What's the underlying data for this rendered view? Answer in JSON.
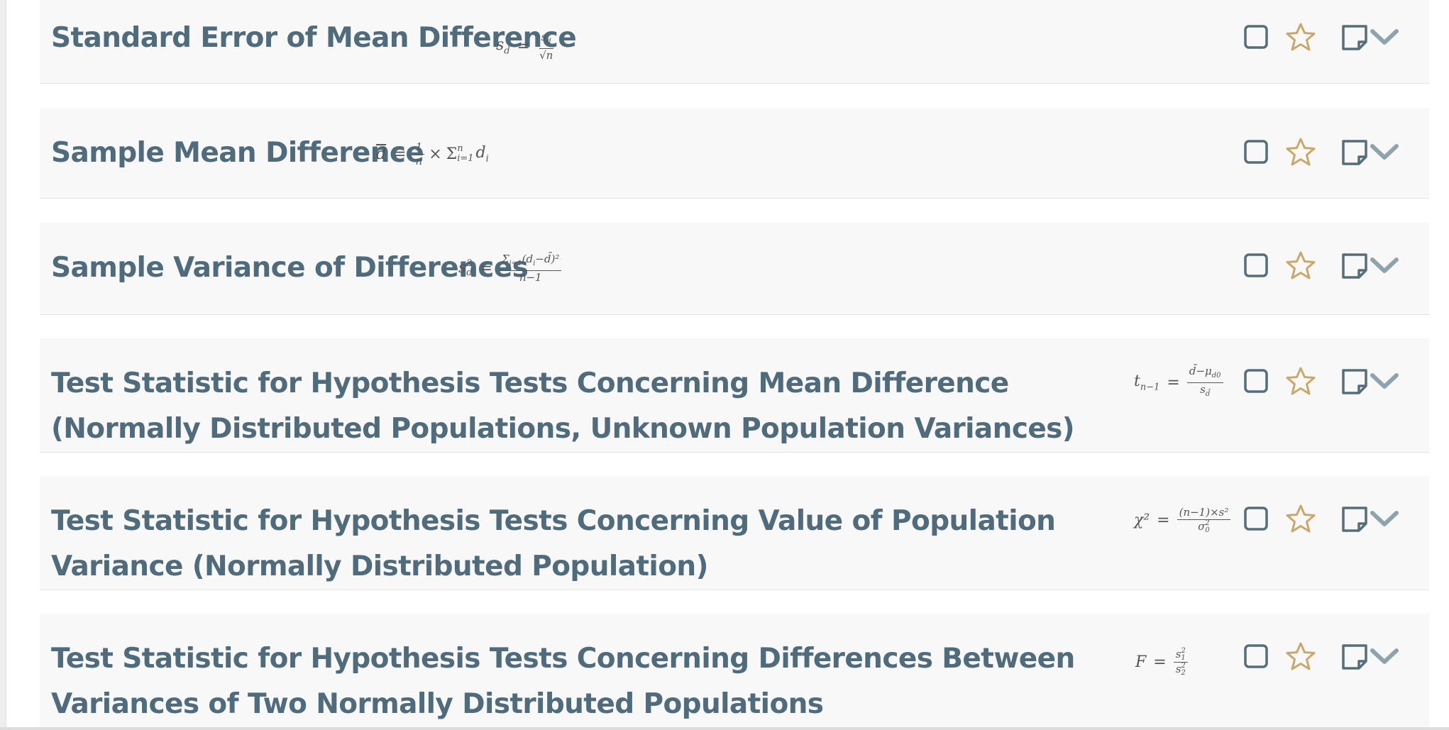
{
  "colors": {
    "title": "#4f6b7c",
    "icon_gray": "#546e7a",
    "star_gold": "#c8a86b",
    "chevron": "#8fa3ad",
    "card_bg": "#f8f8f8"
  },
  "icon_names": [
    "checkbox-icon",
    "star-icon",
    "note-icon",
    "chevron-down-icon"
  ],
  "formulas": [
    {
      "title": "Standard Error of Mean Difference",
      "lhs": "s_d̄",
      "rhs_num": "s_d",
      "rhs_den": "√n"
    },
    {
      "title": "Sample Mean Difference",
      "lhs": "d̄",
      "rhs": "1/n × Σ_{i=1}^{n} d_i"
    },
    {
      "title": "Sample Variance of Differences",
      "lhs": "s²_d",
      "rhs_num": "Σ_{i=1}^{n} (d_i − d̄)²",
      "rhs_den": "n−1"
    },
    {
      "title": "Test Statistic for Hypothesis Tests Concerning Mean Difference (Normally Distributed Populations, Unknown Population Variances)",
      "lhs": "t_{n−1}",
      "rhs_num": "d̄ − μ_{d0}",
      "rhs_den": "s_d̄"
    },
    {
      "title": "Test Statistic for Hypothesis Tests Concerning Value of Population Variance (Normally Distributed Population)",
      "lhs": "χ²",
      "rhs_num": "(n−1)×s²",
      "rhs_den": "σ²_0"
    },
    {
      "title": "Test Statistic for Hypothesis Tests Concerning Differences Between Variances of Two Normally Distributed Populations",
      "lhs": "F",
      "rhs_num": "s²_1",
      "rhs_den": "s²_2"
    }
  ]
}
